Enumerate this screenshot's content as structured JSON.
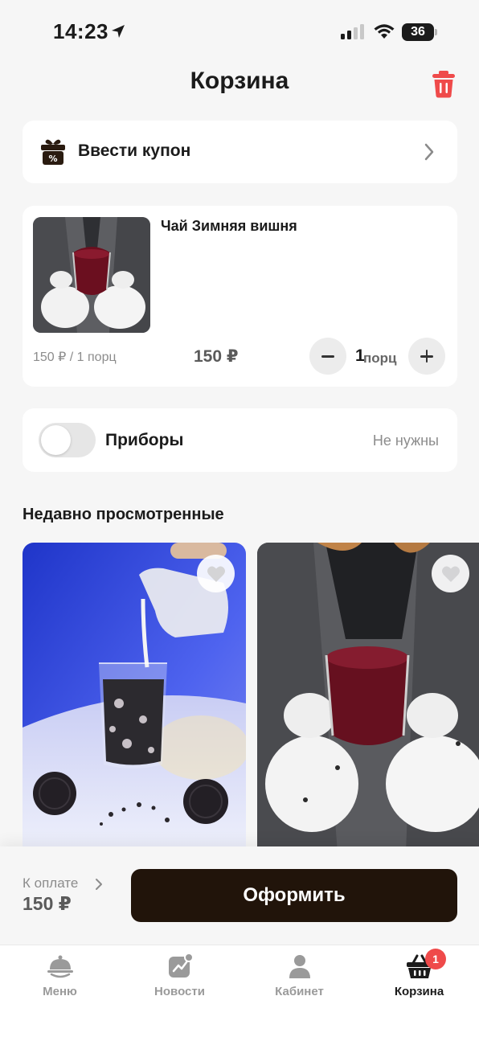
{
  "status_bar": {
    "time": "14:23",
    "battery": "36"
  },
  "header": {
    "title": "Корзина"
  },
  "coupon": {
    "label": "Ввести купон"
  },
  "cart_item": {
    "name": "Чай Зимняя вишня",
    "unit_price": "150 ₽ / 1 порц",
    "total": "150 ₽",
    "quantity": "1",
    "quantity_unit": "порц"
  },
  "utensils": {
    "label": "Приборы",
    "value": "Не нужны",
    "enabled": false
  },
  "recently_viewed": {
    "title": "Недавно просмотренные"
  },
  "checkout": {
    "pay_label": "К оплате",
    "pay_sum": "150 ₽",
    "button_label": "Оформить"
  },
  "tabbar": {
    "items": [
      {
        "label": "Меню",
        "icon": "cloche-icon"
      },
      {
        "label": "Новости",
        "icon": "news-chart-icon"
      },
      {
        "label": "Кабинет",
        "icon": "person-icon"
      },
      {
        "label": "Корзина",
        "icon": "basket-icon",
        "badge": "1",
        "active": true
      }
    ]
  },
  "colors": {
    "accent_dark": "#21140a",
    "trash_red": "#ef4a4a",
    "badge_red": "#ef4a4a"
  }
}
